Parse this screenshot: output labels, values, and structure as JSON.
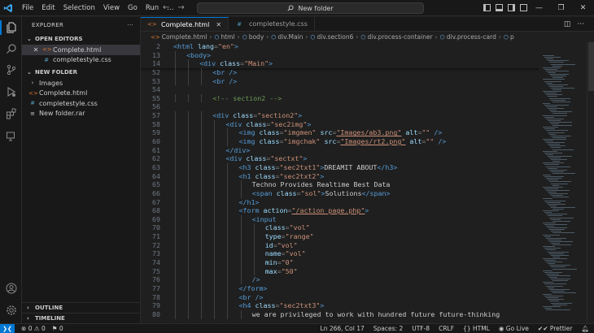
{
  "menu": [
    "File",
    "Edit",
    "Selection",
    "View",
    "Go",
    "Run",
    "…"
  ],
  "nav": {
    "back": "←",
    "forward": "→"
  },
  "command_center": {
    "text": "New folder"
  },
  "window_controls": {
    "minimize": "—",
    "restore": "❐",
    "close": "✕"
  },
  "sidebar": {
    "title": "EXPLORER",
    "more": "···",
    "open_editors_label": "OPEN EDITORS",
    "open_editors": [
      {
        "name": "Complete.html",
        "type": "html",
        "selected": true
      },
      {
        "name": "completestyle.css",
        "type": "css",
        "selected": false
      }
    ],
    "folder_label": "NEW FOLDER",
    "files": [
      {
        "name": "Images",
        "type": "folder"
      },
      {
        "name": "Complete.html",
        "type": "html"
      },
      {
        "name": "completestyle.css",
        "type": "css"
      },
      {
        "name": "New folder.rar",
        "type": "file"
      }
    ],
    "outline_label": "OUTLINE",
    "timeline_label": "TIMELINE"
  },
  "tabs": [
    {
      "label": "Complete.html",
      "type": "html",
      "active": true
    },
    {
      "label": "completestyle.css",
      "type": "css",
      "active": false
    }
  ],
  "tab_actions": {
    "split": "◫",
    "more": "···"
  },
  "breadcrumbs": [
    "Complete.html",
    "html",
    "body",
    "div.Main",
    "div.section6",
    "div.process-container",
    "div.process-card",
    "p"
  ],
  "code_lines": [
    {
      "n": "2",
      "indent": 0,
      "sticky": true,
      "tokens": [
        [
          "t",
          "<html "
        ],
        [
          "a",
          "lang"
        ],
        [
          "p",
          "="
        ],
        [
          "s",
          "\"en\""
        ],
        [
          "t",
          ">"
        ]
      ]
    },
    {
      "n": "13",
      "indent": 1,
      "sticky": true,
      "tokens": [
        [
          "t",
          "<body>"
        ]
      ]
    },
    {
      "n": "14",
      "indent": 2,
      "sticky": true,
      "tokens": [
        [
          "t",
          "<div "
        ],
        [
          "a",
          "class"
        ],
        [
          "p",
          "="
        ],
        [
          "s",
          "\"Main\""
        ],
        [
          "t",
          ">"
        ]
      ]
    },
    {
      "n": "52",
      "indent": 3,
      "tokens": [
        [
          "t",
          "<br />"
        ]
      ]
    },
    {
      "n": "53",
      "indent": 3,
      "tokens": [
        [
          "t",
          "<br />"
        ]
      ]
    },
    {
      "n": "54",
      "indent": 0,
      "tokens": []
    },
    {
      "n": "55",
      "indent": 3,
      "tokens": [
        [
          "c",
          "<!-- section2 -->"
        ]
      ]
    },
    {
      "n": "56",
      "indent": 0,
      "tokens": []
    },
    {
      "n": "57",
      "indent": 3,
      "tokens": [
        [
          "t",
          "<div "
        ],
        [
          "a",
          "class"
        ],
        [
          "p",
          "="
        ],
        [
          "s",
          "\"section2\""
        ],
        [
          "t",
          ">"
        ]
      ]
    },
    {
      "n": "58",
      "indent": 4,
      "tokens": [
        [
          "t",
          "<div "
        ],
        [
          "a",
          "class"
        ],
        [
          "p",
          "="
        ],
        [
          "s",
          "\"sec2img\""
        ],
        [
          "t",
          ">"
        ]
      ]
    },
    {
      "n": "59",
      "indent": 5,
      "tokens": [
        [
          "t",
          "<img "
        ],
        [
          "a",
          "class"
        ],
        [
          "p",
          "="
        ],
        [
          "s",
          "\"imgmen\""
        ],
        [
          "p",
          " "
        ],
        [
          "a",
          "src"
        ],
        [
          "p",
          "="
        ],
        [
          "s",
          "\"Images/ab3.png\""
        ],
        [
          "p",
          " "
        ],
        [
          "a",
          "alt"
        ],
        [
          "p",
          "="
        ],
        [
          "s",
          "\"\""
        ],
        [
          "t",
          " />"
        ]
      ]
    },
    {
      "n": "60",
      "indent": 5,
      "tokens": [
        [
          "t",
          "<img "
        ],
        [
          "a",
          "class"
        ],
        [
          "p",
          "="
        ],
        [
          "s",
          "\"imgchak\""
        ],
        [
          "p",
          " "
        ],
        [
          "a",
          "src"
        ],
        [
          "p",
          "="
        ],
        [
          "s",
          "\"Images/rt2.png\""
        ],
        [
          "p",
          " "
        ],
        [
          "a",
          "alt"
        ],
        [
          "p",
          "="
        ],
        [
          "s",
          "\"\""
        ],
        [
          "t",
          " />"
        ]
      ]
    },
    {
      "n": "61",
      "indent": 4,
      "tokens": [
        [
          "t",
          "</div>"
        ]
      ]
    },
    {
      "n": "62",
      "indent": 4,
      "tokens": [
        [
          "t",
          "<div "
        ],
        [
          "a",
          "class"
        ],
        [
          "p",
          "="
        ],
        [
          "s",
          "\"sectxt\""
        ],
        [
          "t",
          ">"
        ]
      ]
    },
    {
      "n": "63",
      "indent": 5,
      "tokens": [
        [
          "t",
          "<h3 "
        ],
        [
          "a",
          "class"
        ],
        [
          "p",
          "="
        ],
        [
          "s",
          "\"sec2txt1\""
        ],
        [
          "t",
          ">"
        ],
        [
          "x",
          "DREAMIT ABOUT"
        ],
        [
          "t",
          "</h3>"
        ]
      ]
    },
    {
      "n": "64",
      "indent": 5,
      "tokens": [
        [
          "t",
          "<h1 "
        ],
        [
          "a",
          "class"
        ],
        [
          "p",
          "="
        ],
        [
          "s",
          "\"sec2txt2\""
        ],
        [
          "t",
          ">"
        ]
      ]
    },
    {
      "n": "65",
      "indent": 6,
      "tokens": [
        [
          "x",
          "Techno Provides Realtime Best Data"
        ]
      ]
    },
    {
      "n": "66",
      "indent": 6,
      "tokens": [
        [
          "t",
          "<span "
        ],
        [
          "a",
          "class"
        ],
        [
          "p",
          "="
        ],
        [
          "s",
          "\"sol\""
        ],
        [
          "t",
          ">"
        ],
        [
          "x",
          "Solutions"
        ],
        [
          "t",
          "</span>"
        ]
      ]
    },
    {
      "n": "67",
      "indent": 5,
      "tokens": [
        [
          "t",
          "</h1>"
        ]
      ]
    },
    {
      "n": "68",
      "indent": 5,
      "tokens": [
        [
          "t",
          "<form "
        ],
        [
          "a",
          "action"
        ],
        [
          "p",
          "="
        ],
        [
          "s",
          "\"/action_page.php\""
        ],
        [
          "t",
          ">"
        ]
      ]
    },
    {
      "n": "69",
      "indent": 6,
      "tokens": [
        [
          "t",
          "<input"
        ]
      ]
    },
    {
      "n": "70",
      "indent": 7,
      "tokens": [
        [
          "a",
          "class"
        ],
        [
          "p",
          "="
        ],
        [
          "s",
          "\"vol\""
        ]
      ]
    },
    {
      "n": "71",
      "indent": 7,
      "tokens": [
        [
          "a",
          "type"
        ],
        [
          "p",
          "="
        ],
        [
          "s",
          "\"range\""
        ]
      ]
    },
    {
      "n": "72",
      "indent": 7,
      "tokens": [
        [
          "a",
          "id"
        ],
        [
          "p",
          "="
        ],
        [
          "s",
          "\"vol\""
        ]
      ]
    },
    {
      "n": "73",
      "indent": 7,
      "tokens": [
        [
          "a",
          "name"
        ],
        [
          "p",
          "="
        ],
        [
          "s",
          "\"vol\""
        ]
      ]
    },
    {
      "n": "74",
      "indent": 7,
      "tokens": [
        [
          "a",
          "min"
        ],
        [
          "p",
          "="
        ],
        [
          "s",
          "\"0\""
        ]
      ]
    },
    {
      "n": "75",
      "indent": 7,
      "tokens": [
        [
          "a",
          "max"
        ],
        [
          "p",
          "="
        ],
        [
          "s",
          "\"50\""
        ]
      ]
    },
    {
      "n": "76",
      "indent": 6,
      "tokens": [
        [
          "t",
          "/>"
        ]
      ]
    },
    {
      "n": "77",
      "indent": 5,
      "tokens": [
        [
          "t",
          "</form>"
        ]
      ]
    },
    {
      "n": "78",
      "indent": 5,
      "tokens": [
        [
          "t",
          "<br />"
        ]
      ]
    },
    {
      "n": "79",
      "indent": 5,
      "tokens": [
        [
          "t",
          "<h4 "
        ],
        [
          "a",
          "class"
        ],
        [
          "p",
          "="
        ],
        [
          "s",
          "\"sec2txt3\""
        ],
        [
          "t",
          ">"
        ]
      ]
    },
    {
      "n": "80",
      "indent": 6,
      "tokens": [
        [
          "x",
          "we are privileged to work with hundred future future-thinking"
        ]
      ]
    }
  ],
  "status": {
    "errors": "0",
    "warnings": "0",
    "ports": "0",
    "position": "Ln 266, Col 17",
    "spaces": "Spaces: 2",
    "encoding": "UTF-8",
    "eol": "CRLF",
    "language": "HTML",
    "golive": "Go Live",
    "prettier": "Prettier"
  },
  "colors": {
    "accent": "#0078d4",
    "html_icon": "#e37933",
    "css_icon": "#519aba"
  }
}
